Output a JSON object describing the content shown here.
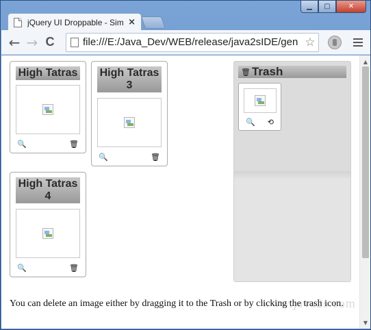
{
  "window": {
    "minimize_label": "▁",
    "maximize_label": "▢",
    "close_label": "✕"
  },
  "tab": {
    "title": "jQuery UI Droppable - Sim",
    "close_label": "×"
  },
  "toolbar": {
    "back_label": "←",
    "forward_label": "→",
    "reload_label": "C",
    "url": "file:///E:/Java_Dev/WEB/release/java2sIDE/gen",
    "star_label": "☆"
  },
  "gallery": {
    "items": [
      {
        "title": "High Tatras",
        "zoom_icon": "🔍",
        "trash_icon": "🗑"
      },
      {
        "title": "High Tatras 3",
        "zoom_icon": "🔍",
        "trash_icon": "🗑"
      },
      {
        "title": "High Tatras 4",
        "zoom_icon": "🔍",
        "trash_icon": "🗑"
      }
    ]
  },
  "trash": {
    "title": "Trash",
    "icon": "🗑",
    "item": {
      "zoom_icon": "🔍",
      "recycle_icon": "⟲"
    }
  },
  "note": "You can delete an image either by dragging it to the Trash or by clicking the trash icon.",
  "watermark": "www.java2s.com"
}
